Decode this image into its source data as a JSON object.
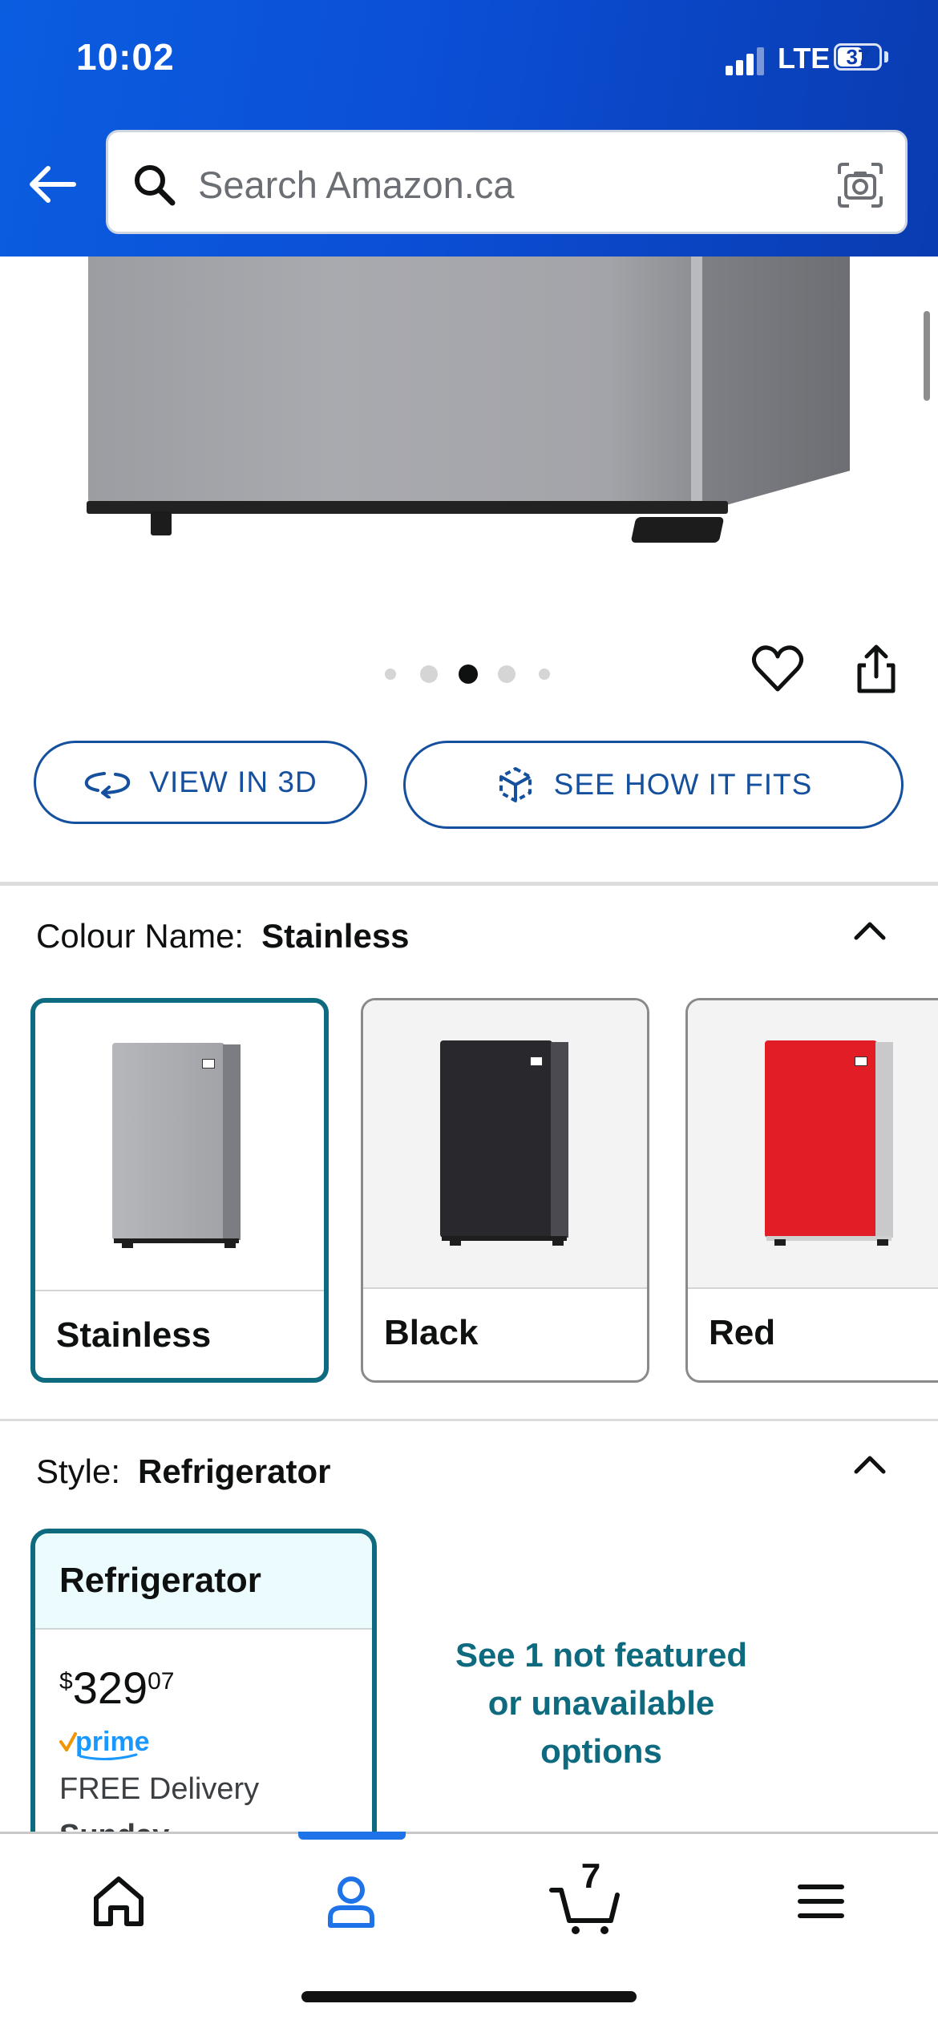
{
  "status_bar": {
    "time": "10:02",
    "network": "LTE",
    "battery": "37"
  },
  "header": {
    "search_placeholder": "Search Amazon.ca",
    "icons": [
      "back-arrow-icon",
      "search-icon",
      "camera-icon"
    ],
    "background_color": "#0b5de0"
  },
  "gallery": {
    "image_count": 5,
    "active_index": 2,
    "icons": [
      "heart-icon",
      "share-icon"
    ]
  },
  "actions": {
    "view_3d_label": "VIEW IN 3D",
    "see_fit_label": "SEE HOW IT FITS",
    "accent_color": "#15509e"
  },
  "colour": {
    "label": "Colour Name:",
    "selected": "Stainless",
    "options": [
      {
        "name": "Stainless",
        "color": "#a7a8ad"
      },
      {
        "name": "Black",
        "color": "#28272b"
      },
      {
        "name": "Red",
        "color": "#e21d25"
      }
    ]
  },
  "style": {
    "label": "Style:",
    "selected": "Refrigerator",
    "card": {
      "title": "Refrigerator",
      "price_currency": "$",
      "price_whole": "329",
      "price_fraction": "07",
      "prime_label": "prime",
      "delivery": "FREE Delivery",
      "delivery_day": "Sunday"
    },
    "more_options_lines": [
      "See 1 not featured",
      "or unavailable",
      "options"
    ],
    "accent_color": "#0e6b7f"
  },
  "tabbar": {
    "items": [
      "home",
      "account",
      "cart",
      "menu"
    ],
    "active": "account",
    "cart_count": "7"
  }
}
